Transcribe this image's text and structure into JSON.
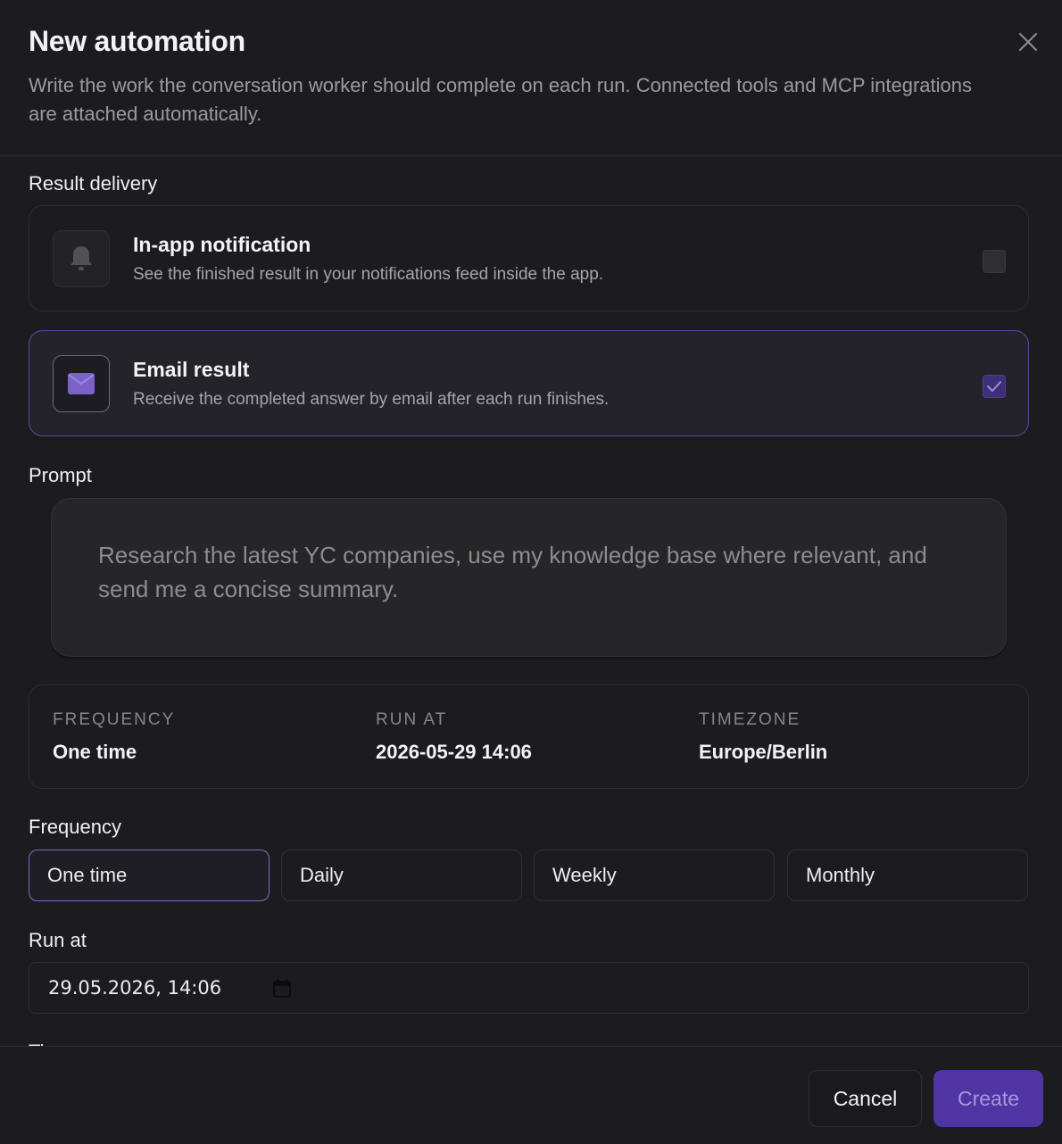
{
  "dialog": {
    "title": "New automation",
    "subtitle": "Write the work the conversation worker should complete on each run. Connected tools and MCP integrations are attached automatically."
  },
  "delivery": {
    "section_label": "Result delivery",
    "options": [
      {
        "title": "In-app notification",
        "description": "See the finished result in your notifications feed inside the app.",
        "icon": "bell-icon",
        "checked": false
      },
      {
        "title": "Email result",
        "description": "Receive the completed answer by email after each run finishes.",
        "icon": "envelope-icon",
        "checked": true
      }
    ]
  },
  "prompt": {
    "label": "Prompt",
    "placeholder": "Research the latest YC companies, use my knowledge base where relevant, and send me a concise summary."
  },
  "summary": [
    {
      "heading": "FREQUENCY",
      "value": "One time"
    },
    {
      "heading": "RUN AT",
      "value": "2026-05-29 14:06"
    },
    {
      "heading": "TIMEZONE",
      "value": "Europe/Berlin"
    }
  ],
  "frequency": {
    "label": "Frequency",
    "options": [
      "One time",
      "Daily",
      "Weekly",
      "Monthly"
    ],
    "selected": "One time"
  },
  "run_at": {
    "label": "Run at",
    "value": "29.05.2026, 14:06",
    "icon": "calendar-icon"
  },
  "timezone": {
    "label_partial": "Ti"
  },
  "footer": {
    "cancel_label": "Cancel",
    "create_label": "Create"
  },
  "colors": {
    "background": "#1c1c20",
    "accent": "#4f35a3",
    "accent_border": "#7b6bc8",
    "muted_text": "#9a9aa3"
  }
}
